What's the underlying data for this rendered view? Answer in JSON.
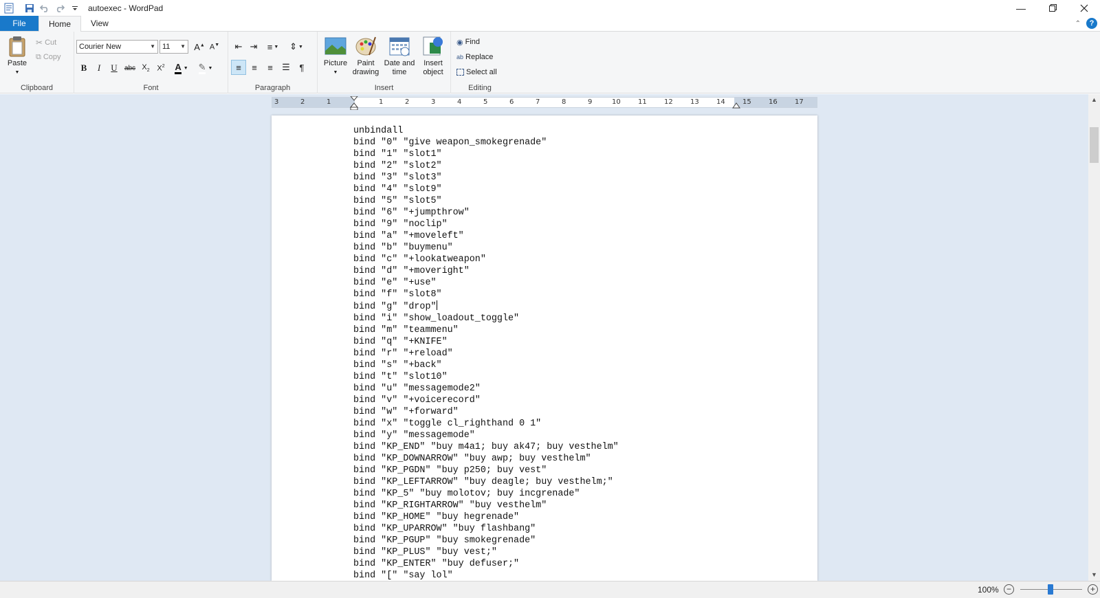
{
  "window": {
    "title": "autoexec - WordPad"
  },
  "tabs": {
    "file": "File",
    "home": "Home",
    "view": "View"
  },
  "clipboard": {
    "paste": "Paste",
    "cut": "Cut",
    "copy": "Copy",
    "label": "Clipboard"
  },
  "font": {
    "family": "Courier New",
    "size": "11",
    "label": "Font"
  },
  "paragraph": {
    "label": "Paragraph"
  },
  "insert": {
    "picture": "Picture",
    "paint_drawing_1": "Paint",
    "paint_drawing_2": "drawing",
    "date_time_1": "Date and",
    "date_time_2": "time",
    "insert_object_1": "Insert",
    "insert_object_2": "object",
    "label": "Insert"
  },
  "editing": {
    "find": "Find",
    "replace": "Replace",
    "select_all": "Select all",
    "label": "Editing"
  },
  "ruler": {
    "numbers": [
      "3",
      "2",
      "1",
      "1",
      "2",
      "3",
      "4",
      "5",
      "6",
      "7",
      "8",
      "9",
      "10",
      "11",
      "12",
      "13",
      "14",
      "15",
      "16",
      "17"
    ]
  },
  "document": {
    "lines_before_caret": "unbindall\nbind \"0\" \"give weapon_smokegrenade\"\nbind \"1\" \"slot1\"\nbind \"2\" \"slot2\"\nbind \"3\" \"slot3\"\nbind \"4\" \"slot9\"\nbind \"5\" \"slot5\"\nbind \"6\" \"+jumpthrow\"\nbind \"9\" \"noclip\"\nbind \"a\" \"+moveleft\"\nbind \"b\" \"buymenu\"\nbind \"c\" \"+lookatweapon\"\nbind \"d\" \"+moveright\"\nbind \"e\" \"+use\"\nbind \"f\" \"slot8\"\nbind \"g\" \"drop\"",
    "lines_after_caret": "\nbind \"i\" \"show_loadout_toggle\"\nbind \"m\" \"teammenu\"\nbind \"q\" \"+KNIFE\"\nbind \"r\" \"+reload\"\nbind \"s\" \"+back\"\nbind \"t\" \"slot10\"\nbind \"u\" \"messagemode2\"\nbind \"v\" \"+voicerecord\"\nbind \"w\" \"+forward\"\nbind \"x\" \"toggle cl_righthand 0 1\"\nbind \"y\" \"messagemode\"\nbind \"KP_END\" \"buy m4a1; buy ak47; buy vesthelm\"\nbind \"KP_DOWNARROW\" \"buy awp; buy vesthelm\"\nbind \"KP_PGDN\" \"buy p250; buy vest\"\nbind \"KP_LEFTARROW\" \"buy deagle; buy vesthelm;\"\nbind \"KP_5\" \"buy molotov; buy incgrenade\"\nbind \"KP_RIGHTARROW\" \"buy vesthelm\"\nbind \"KP_HOME\" \"buy hegrenade\"\nbind \"KP_UPARROW\" \"buy flashbang\"\nbind \"KP_PGUP\" \"buy smokegrenade\"\nbind \"KP_PLUS\" \"buy vest;\"\nbind \"KP_ENTER\" \"buy defuser;\"\nbind \"[\" \"say lol\""
  },
  "status": {
    "zoom": "100%"
  },
  "colors": {
    "accent": "#1979ca",
    "ribbon_bg": "#f5f6f7",
    "workspace_bg": "#dfe8f3"
  }
}
